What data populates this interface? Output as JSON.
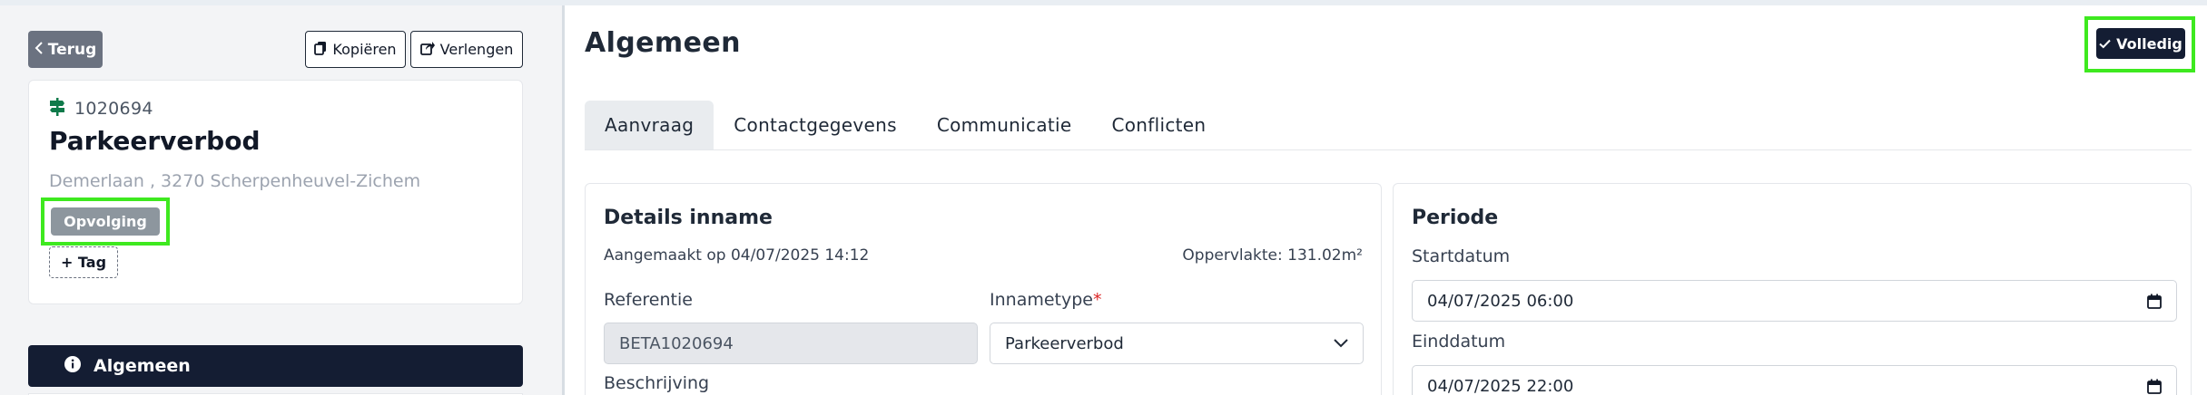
{
  "sidebar": {
    "back_label": "Terug",
    "copy_label": "Kopiëren",
    "extend_label": "Verlengen",
    "record_id": "1020694",
    "record_title": "Parkeerverbod",
    "record_address": "Demerlaan , 3270 Scherpenheuvel-Zichem",
    "status_badge": "Opvolging",
    "add_tag_label": "+ Tag",
    "nav_active_label": "Algemeen",
    "icons": [
      "chevron-left-icon",
      "copy-icon",
      "share-icon",
      "signpost-icon",
      "info-icon"
    ]
  },
  "main": {
    "title": "Algemeen",
    "complete_label": "Volledig",
    "tabs": [
      {
        "label": "Aanvraag",
        "active": true
      },
      {
        "label": "Contactgegevens",
        "active": false
      },
      {
        "label": "Communicatie",
        "active": false
      },
      {
        "label": "Conflicten",
        "active": false
      }
    ],
    "details": {
      "title": "Details inname",
      "created": "Aangemaakt op 04/07/2025 14:12",
      "area": "Oppervlakte: 131.02m²",
      "reference_label": "Referentie",
      "reference_value": "BETA1020694",
      "type_label": "Innametype",
      "required_mark": "*",
      "type_value": "Parkeerverbod",
      "description_label": "Beschrijving"
    },
    "period": {
      "title": "Periode",
      "start_label": "Startdatum",
      "start_value": "04/07/2025 06:00",
      "end_label": "Einddatum",
      "end_value": "04/07/2025 22:00"
    }
  },
  "colors": {
    "primary_dark": "#141d33",
    "badge_gray": "#8d969e",
    "back_button_gray": "#6b7280",
    "highlight_green": "#3ee91f",
    "signpost_green": "#0f7a4a"
  }
}
